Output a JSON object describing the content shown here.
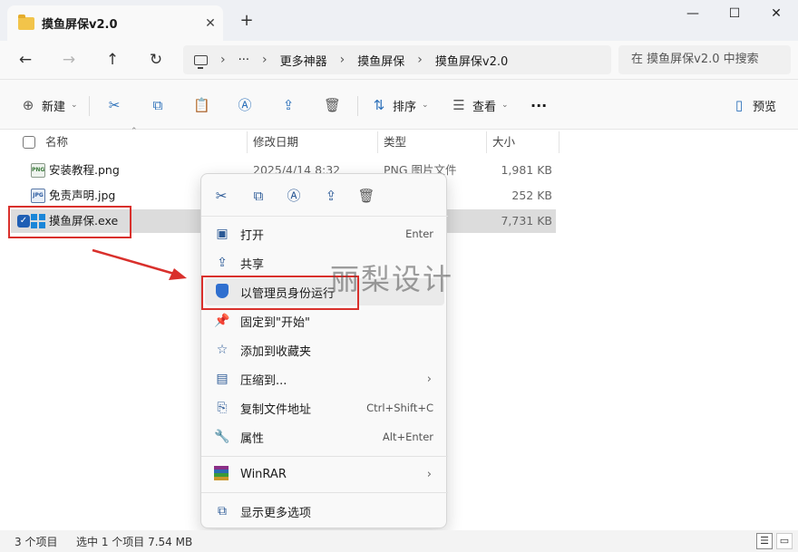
{
  "window": {
    "tab_title": "摸鱼屏保v2.0",
    "tab_close": "✕",
    "new_tab": "+",
    "minimize": "—",
    "maximize": "☐",
    "close": "✕"
  },
  "address": {
    "more": "···",
    "crumbs": [
      "更多神器",
      "摸鱼屏保",
      "摸鱼屏保v2.0"
    ],
    "separator": "›",
    "search_placeholder": "在 摸鱼屏保v2.0 中搜索"
  },
  "toolbar": {
    "new_label": "新建",
    "sort_label": "排序",
    "view_label": "查看",
    "more": "···",
    "preview_label": "预览"
  },
  "columns": {
    "name": "名称",
    "modified": "修改日期",
    "type": "类型",
    "size": "大小"
  },
  "files": [
    {
      "name": "安装教程.png",
      "modified": "2025/4/14 8:32",
      "type": "PNG 图片文件",
      "size": "1,981 KB",
      "icon": "png-file-icon"
    },
    {
      "name": "免责声明.jpg",
      "modified": "",
      "type": "",
      "size": "252 KB",
      "icon": "jpg-file-icon"
    },
    {
      "name": "摸鱼屏保.exe",
      "modified": "",
      "type": "",
      "size": "7,731 KB",
      "icon": "exe-app-icon",
      "selected": true
    }
  ],
  "context_menu": {
    "items": [
      {
        "label": "打开",
        "key": "Enter",
        "icon": "open-icon"
      },
      {
        "label": "共享",
        "key": "",
        "icon": "share-icon"
      },
      {
        "label": "以管理员身份运行",
        "key": "",
        "icon": "shield-icon"
      },
      {
        "label": "固定到\"开始\"",
        "key": "",
        "icon": "pin-icon"
      },
      {
        "label": "添加到收藏夹",
        "key": "",
        "icon": "star-icon"
      },
      {
        "label": "压缩到...",
        "key": "",
        "icon": "zip-icon",
        "submenu": "›"
      },
      {
        "label": "复制文件地址",
        "key": "Ctrl+Shift+C",
        "icon": "copy-path-icon"
      },
      {
        "label": "属性",
        "key": "Alt+Enter",
        "icon": "wrench-icon"
      },
      {
        "label": "WinRAR",
        "key": "",
        "icon": "winrar-icon",
        "submenu": "›"
      },
      {
        "label": "显示更多选项",
        "key": "",
        "icon": "more-options-icon"
      }
    ]
  },
  "watermark": "丽梨设计",
  "status": {
    "count": "3 个项目",
    "selection": "选中 1 个项目  7.54 MB"
  },
  "colors": {
    "accent": "#2c5a96",
    "highlight_box": "#d9302c",
    "selection_bg": "#dcdcdc"
  }
}
